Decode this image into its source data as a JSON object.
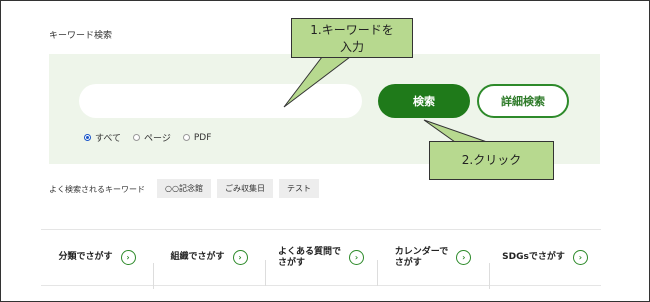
{
  "search": {
    "section_title": "キーワード検索",
    "input_value": "",
    "search_button": "検索",
    "detail_button": "詳細検索",
    "radios": [
      {
        "label": "すべて",
        "checked": true
      },
      {
        "label": "ページ",
        "checked": false
      },
      {
        "label": "PDF",
        "checked": false
      }
    ]
  },
  "keywords": {
    "label": "よく検索されるキーワード",
    "tags": [
      "○○記念館",
      "ごみ収集日",
      "テスト"
    ]
  },
  "nav": [
    {
      "label": "分類でさがす"
    },
    {
      "label": "組織でさがす"
    },
    {
      "label": "よくある質問で\nさがす"
    },
    {
      "label": "カレンダーで\nさがす"
    },
    {
      "label": "SDGsでさがす"
    }
  ],
  "callouts": {
    "first": "1.キーワードを\n入力",
    "second": "2.クリック"
  },
  "colors": {
    "accent": "#1f7a1a",
    "panel": "#eef5ea",
    "callout": "#b7d98f"
  },
  "icons": {
    "nav_arrow": "chevron-right-circle-icon"
  }
}
